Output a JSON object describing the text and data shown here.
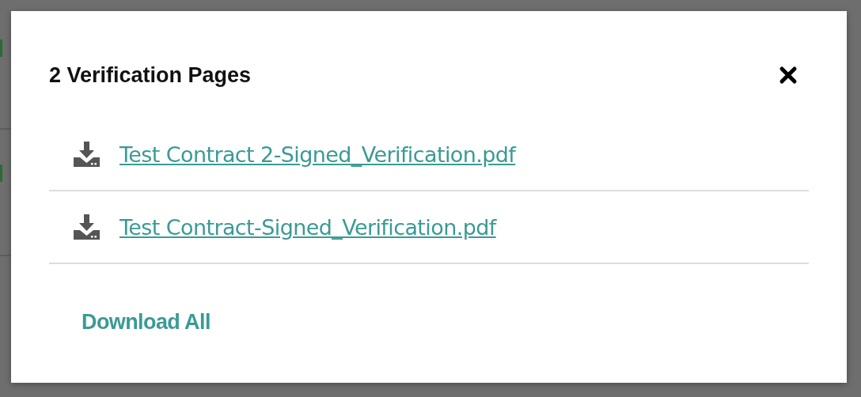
{
  "dialog": {
    "title": "2 Verification Pages",
    "files": [
      {
        "name": "Test Contract 2-Signed_Verification.pdf"
      },
      {
        "name": "Test Contract-Signed_Verification.pdf"
      }
    ],
    "download_all": "Download All"
  }
}
